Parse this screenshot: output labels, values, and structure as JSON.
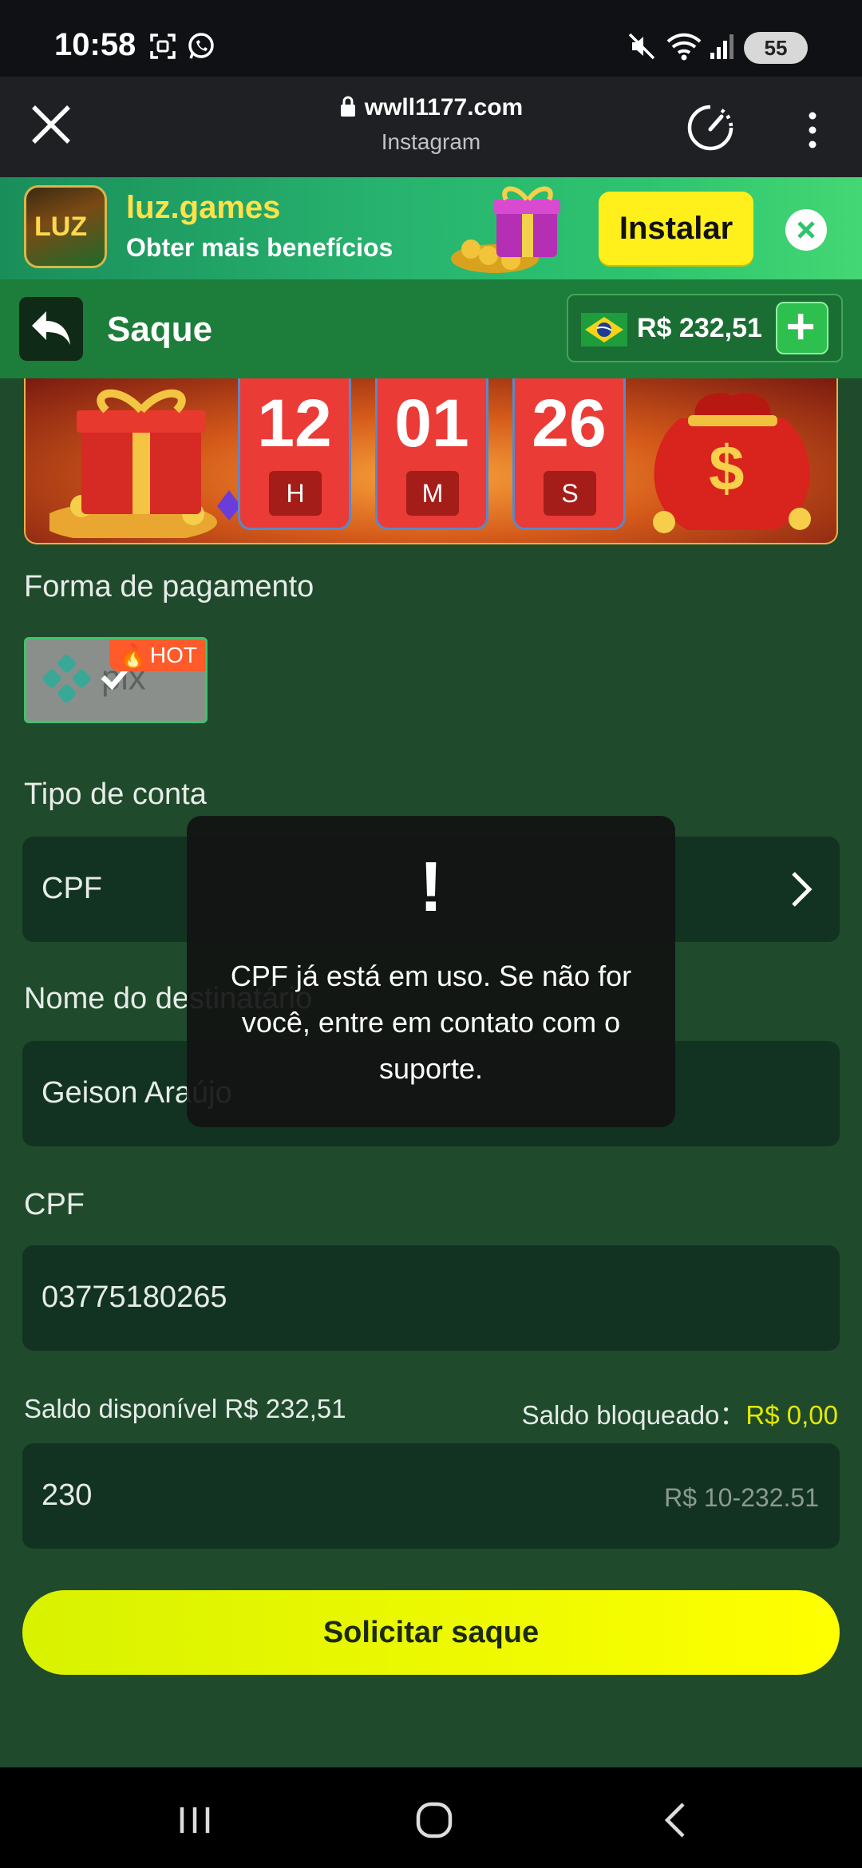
{
  "status_bar": {
    "time": "10:58",
    "battery": "55"
  },
  "browser": {
    "url": "wwll1177.com",
    "source": "Instagram"
  },
  "ad_banner": {
    "app_icon_text": "LUZ",
    "brand": "luz.games",
    "tagline": "Obter mais benefícios",
    "install_label": "Instalar"
  },
  "header": {
    "title": "Saque",
    "balance": "R$ 232,51"
  },
  "countdown": {
    "hours": "12",
    "minutes": "01",
    "seconds": "26",
    "hours_label": "H",
    "minutes_label": "M",
    "seconds_label": "S"
  },
  "form": {
    "payment_method_label": "Forma de pagamento",
    "payment_option": "pix",
    "hot_badge": "HOT",
    "account_type_label": "Tipo de conta",
    "account_type_value": "CPF",
    "recipient_label": "Nome do destinatário",
    "recipient_value": "Geison Araújo",
    "cpf_label": "CPF",
    "cpf_value": "03775180265",
    "available_balance": "Saldo disponível R$ 232,51",
    "blocked_label": "Saldo bloqueado：",
    "blocked_value": "R$ 0,00",
    "amount_value": "230",
    "amount_hint": "R$ 10-232.51",
    "submit_label": "Solicitar saque"
  },
  "toast": {
    "icon": "!",
    "message": "CPF já está em uso. Se não for você, entre em contato com o suporte."
  },
  "colors": {
    "header_green": "#1d7d3a",
    "page_green": "#1f4a2c",
    "field_bg": "#133322",
    "accent_yellow": "#e3e800",
    "submit_yellow": "#ffff00"
  }
}
